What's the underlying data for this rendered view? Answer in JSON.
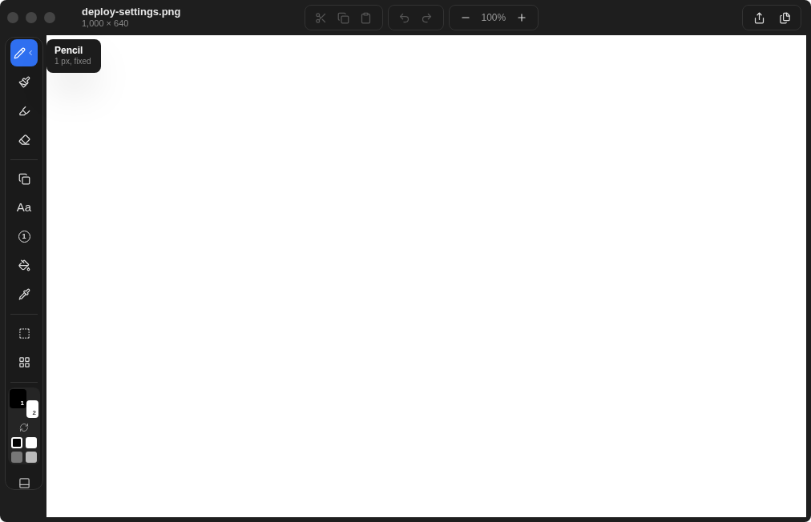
{
  "window": {
    "title": "deploy-settings.png",
    "subtitle": "1,000 × 640"
  },
  "toolbar": {
    "edit": [
      {
        "kind": "cut",
        "disabled": true
      },
      {
        "kind": "copy",
        "disabled": true
      },
      {
        "kind": "paste",
        "disabled": true
      }
    ],
    "history": [
      {
        "kind": "undo",
        "disabled": true
      },
      {
        "kind": "redo",
        "disabled": true
      }
    ],
    "zoom": {
      "value": "100%"
    }
  },
  "tools": [
    {
      "kind": "pencil",
      "selected": true
    },
    {
      "kind": "brush",
      "selected": false
    },
    {
      "kind": "highlighter",
      "selected": false
    },
    {
      "kind": "eraser",
      "selected": false
    },
    {
      "kind": "divider"
    },
    {
      "kind": "shapes",
      "selected": false
    },
    {
      "kind": "text",
      "label": "Aa",
      "selected": false
    },
    {
      "kind": "counter",
      "label": "1",
      "selected": false
    },
    {
      "kind": "fill",
      "selected": false
    },
    {
      "kind": "eyedropper",
      "selected": false
    },
    {
      "kind": "divider"
    },
    {
      "kind": "select",
      "selected": false
    },
    {
      "kind": "grid",
      "selected": false
    }
  ],
  "colors": {
    "primary": {
      "color": "#000000",
      "label": "1"
    },
    "secondary": {
      "color": "#ffffff",
      "label": "2"
    },
    "swatches": [
      {
        "color": "#000000"
      },
      {
        "color": "#ffffff"
      },
      {
        "color": "#777777"
      },
      {
        "color": "#bbbbbb"
      }
    ]
  },
  "tooltip": {
    "title": "Pencil",
    "detail": "1 px, fixed"
  }
}
